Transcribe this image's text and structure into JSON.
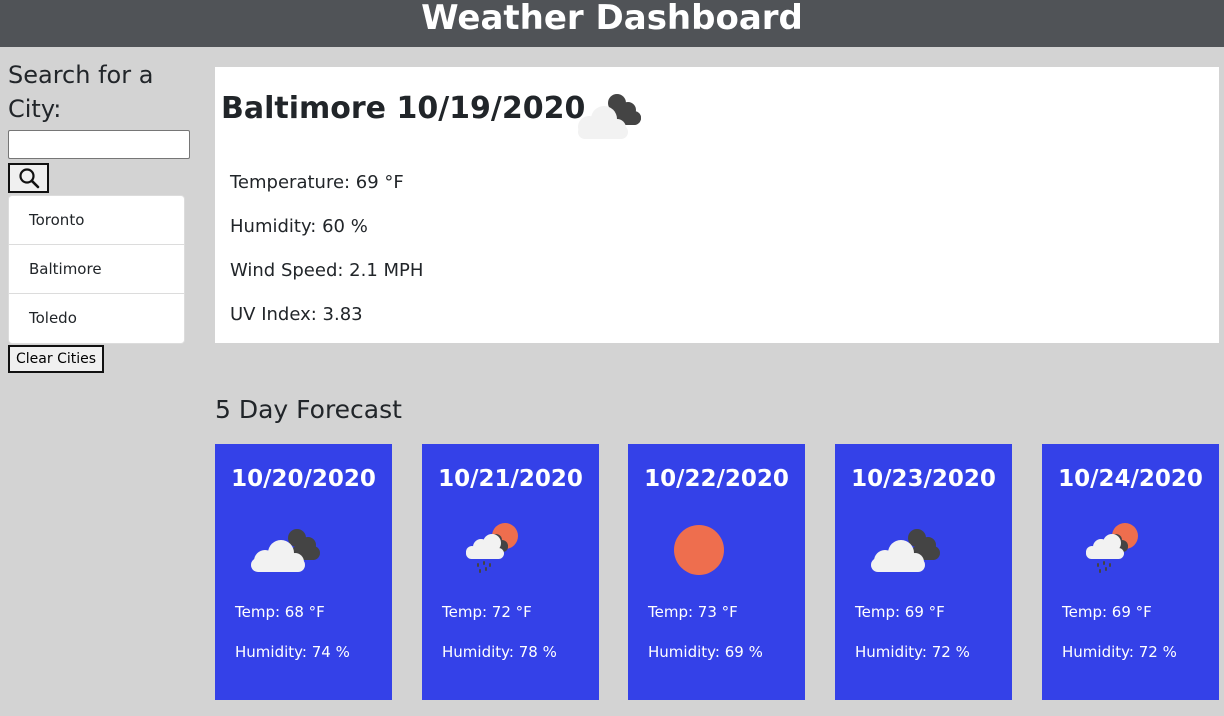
{
  "header": {
    "title": "Weather Dashboard"
  },
  "sidebar": {
    "heading": "Search for a City:",
    "search": {
      "value": "",
      "placeholder": ""
    },
    "search_icon": "search-icon",
    "cities": [
      {
        "label": "Toronto"
      },
      {
        "label": "Baltimore"
      },
      {
        "label": "Toledo"
      }
    ],
    "clear_label": "Clear Cities"
  },
  "current": {
    "title": "Baltimore 10/19/2020",
    "icon": "broken-clouds-icon",
    "temperature": "Temperature: 69 °F",
    "humidity": "Humidity: 60 %",
    "wind": "Wind Speed: 2.1 MPH",
    "uv": "UV Index: 3.83"
  },
  "forecast": {
    "title": "5 Day Forecast",
    "days": [
      {
        "date": "10/20/2020",
        "icon": "broken-clouds-icon",
        "temp": "Temp: 68 °F",
        "humidity": "Humidity: 74 %"
      },
      {
        "date": "10/21/2020",
        "icon": "rain-icon",
        "temp": "Temp: 72 °F",
        "humidity": "Humidity: 78 %"
      },
      {
        "date": "10/22/2020",
        "icon": "sun-icon",
        "temp": "Temp: 73 °F",
        "humidity": "Humidity: 69 %"
      },
      {
        "date": "10/23/2020",
        "icon": "broken-clouds-icon",
        "temp": "Temp: 69 °F",
        "humidity": "Humidity: 72 %"
      },
      {
        "date": "10/24/2020",
        "icon": "rain-icon",
        "temp": "Temp: 69 °F",
        "humidity": "Humidity: 72 %"
      }
    ]
  },
  "colors": {
    "header_bg": "#505357",
    "page_bg": "#d3d3d3",
    "card_bg": "#3441e8",
    "sun": "#ee6e4e",
    "cloud_dark": "#444444",
    "cloud_light": "#f2f2f2"
  }
}
